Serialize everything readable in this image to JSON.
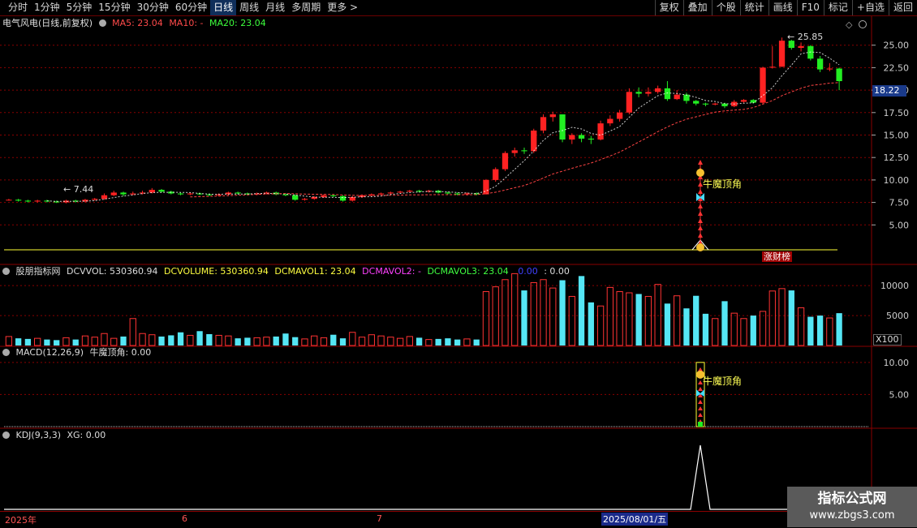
{
  "toolbar": {
    "periods": [
      "分时",
      "1分钟",
      "5分钟",
      "15分钟",
      "30分钟",
      "60分钟",
      "日线",
      "周线",
      "月线",
      "多周期",
      "更多 >"
    ],
    "active_period": "日线",
    "buttons": [
      "复权",
      "叠加",
      "个股",
      "统计",
      "画线",
      "F10",
      "标记",
      "+自选",
      "返回"
    ]
  },
  "main_panel": {
    "title": "电气风电(日线,前复权)",
    "ma5": "MA5: 23.04",
    "ma10": "MA10: -",
    "ma20": "MA20: 23.04",
    "y_ticks": [
      "25.00",
      "22.50",
      "20.00",
      "17.50",
      "15.00",
      "12.50",
      "10.00",
      "7.50",
      "5.00"
    ],
    "price_tag": "18.22",
    "high_label": "25.85",
    "low_label": "7.44",
    "signal_label": "牛魔顶角",
    "badge_label": "涨财榜"
  },
  "volume_panel": {
    "title": "股朋指标网",
    "dcvvol": "DCVVOL: 530360.94",
    "dcvolume": "DCVOLUME: 530360.94",
    "dcmavol1": "DCMAVOL1: 23.04",
    "dcmavol2": "DCMAVOL2: -",
    "dcmavol3": "DCMAVOL3: 23.04",
    "extra1": "0.00",
    "extra2": ": 0.00",
    "y_ticks": [
      "10000",
      "5000"
    ],
    "unit": "X100"
  },
  "macd_panel": {
    "title": "MACD(12,26,9)",
    "value": "牛魔顶角: 0.00",
    "y_ticks": [
      "10.00",
      "5.00"
    ],
    "signal_label": "牛魔顶角"
  },
  "kdj_panel": {
    "title": "KDJ(9,3,3)",
    "value": "XG: 0.00"
  },
  "date_axis": {
    "labels": [
      "2025年",
      "6",
      "7"
    ],
    "cursor_date": "2025/08/01/五"
  },
  "watermark": {
    "title": "指标公式网",
    "url": "www.zbgs3.com"
  },
  "colors": {
    "up": "#ff2222",
    "down": "#22ee22",
    "vol_up": "#ff3333",
    "vol_down": "#55e6f5",
    "grid": "#8a0000",
    "ma5": "#ffffff",
    "ma20": "#ff4444"
  },
  "chart_data": {
    "type": "candlestick",
    "price_range": [
      2.5,
      27.5
    ],
    "candles": [
      [
        7.8,
        7.8,
        7.9,
        7.7
      ],
      [
        7.8,
        7.7,
        7.9,
        7.6
      ],
      [
        7.7,
        7.6,
        7.8,
        7.5
      ],
      [
        7.6,
        7.7,
        7.8,
        7.5
      ],
      [
        7.7,
        7.6,
        7.8,
        7.5
      ],
      [
        7.6,
        7.5,
        7.7,
        7.44
      ],
      [
        7.5,
        7.7,
        7.8,
        7.4
      ],
      [
        7.7,
        7.6,
        7.8,
        7.5
      ],
      [
        7.6,
        7.8,
        7.9,
        7.5
      ],
      [
        7.8,
        7.9,
        8.0,
        7.7
      ],
      [
        7.9,
        8.3,
        8.5,
        7.8
      ],
      [
        8.3,
        8.6,
        8.8,
        8.2
      ],
      [
        8.6,
        8.4,
        8.7,
        8.2
      ],
      [
        8.4,
        8.5,
        8.7,
        8.3
      ],
      [
        8.5,
        8.6,
        8.8,
        8.4
      ],
      [
        8.6,
        8.9,
        9.1,
        8.5
      ],
      [
        8.9,
        8.7,
        9.0,
        8.6
      ],
      [
        8.7,
        8.5,
        8.8,
        8.4
      ],
      [
        8.5,
        8.4,
        8.6,
        8.3
      ],
      [
        8.4,
        8.5,
        8.6,
        8.3
      ],
      [
        8.5,
        8.4,
        8.6,
        8.3
      ],
      [
        8.4,
        8.3,
        8.5,
        8.2
      ],
      [
        8.3,
        8.4,
        8.5,
        8.2
      ],
      [
        8.4,
        8.6,
        8.7,
        8.3
      ],
      [
        8.6,
        8.5,
        8.7,
        8.4
      ],
      [
        8.5,
        8.4,
        8.6,
        8.3
      ],
      [
        8.4,
        8.5,
        8.6,
        8.3
      ],
      [
        8.5,
        8.6,
        8.7,
        8.4
      ],
      [
        8.6,
        8.4,
        8.7,
        8.3
      ],
      [
        8.4,
        8.3,
        8.5,
        8.2
      ],
      [
        8.3,
        7.8,
        8.4,
        7.7
      ],
      [
        7.8,
        7.9,
        8.0,
        7.7
      ],
      [
        7.9,
        8.1,
        8.2,
        7.8
      ],
      [
        8.1,
        8.3,
        8.4,
        8.0
      ],
      [
        8.3,
        8.2,
        8.4,
        8.1
      ],
      [
        8.2,
        7.7,
        8.3,
        7.6
      ],
      [
        7.7,
        8.1,
        8.2,
        7.6
      ],
      [
        8.1,
        8.3,
        8.4,
        8.0
      ],
      [
        8.3,
        8.4,
        8.5,
        8.2
      ],
      [
        8.4,
        8.5,
        8.6,
        8.3
      ],
      [
        8.5,
        8.6,
        8.7,
        8.4
      ],
      [
        8.6,
        8.7,
        8.8,
        8.5
      ],
      [
        8.7,
        8.8,
        8.9,
        8.6
      ],
      [
        8.8,
        8.7,
        8.9,
        8.6
      ],
      [
        8.7,
        8.8,
        8.9,
        8.6
      ],
      [
        8.8,
        8.6,
        8.9,
        8.5
      ],
      [
        8.6,
        8.5,
        8.7,
        8.4
      ],
      [
        8.5,
        8.4,
        8.6,
        8.3
      ],
      [
        8.4,
        8.5,
        8.6,
        8.3
      ],
      [
        8.5,
        8.4,
        8.6,
        8.3
      ],
      [
        8.4,
        10.0,
        10.1,
        8.4
      ],
      [
        10.0,
        11.2,
        11.4,
        9.8
      ],
      [
        11.2,
        13.0,
        13.2,
        11.0
      ],
      [
        13.0,
        13.3,
        13.6,
        12.6
      ],
      [
        13.3,
        13.2,
        13.6,
        12.9
      ],
      [
        13.2,
        15.5,
        15.7,
        13.0
      ],
      [
        15.5,
        17.0,
        17.3,
        15.2
      ],
      [
        17.0,
        17.3,
        17.6,
        16.5
      ],
      [
        17.3,
        14.5,
        17.3,
        14.2
      ],
      [
        14.5,
        15.0,
        15.2,
        14.0
      ],
      [
        15.0,
        14.6,
        15.2,
        14.2
      ],
      [
        14.6,
        14.5,
        14.9,
        14.0
      ],
      [
        14.5,
        16.3,
        16.6,
        14.4
      ],
      [
        16.3,
        16.8,
        17.2,
        16.0
      ],
      [
        16.8,
        17.5,
        17.8,
        16.5
      ],
      [
        17.5,
        19.8,
        20.2,
        17.3
      ],
      [
        19.8,
        19.6,
        20.3,
        19.2
      ],
      [
        19.6,
        19.8,
        20.3,
        19.3
      ],
      [
        19.8,
        20.2,
        20.5,
        19.6
      ],
      [
        20.2,
        19.0,
        21.0,
        18.8
      ],
      [
        19.0,
        19.5,
        20.0,
        18.9
      ],
      [
        19.5,
        18.8,
        19.7,
        18.5
      ],
      [
        18.8,
        18.5,
        18.9,
        18.3
      ],
      [
        18.5,
        18.4,
        18.6,
        18.2
      ],
      [
        18.4,
        18.5,
        18.6,
        18.3
      ],
      [
        18.5,
        18.2,
        18.6,
        18.0
      ],
      [
        18.2,
        18.7,
        18.9,
        18.1
      ],
      [
        18.7,
        18.9,
        19.0,
        18.6
      ],
      [
        18.9,
        18.6,
        19.0,
        18.5
      ],
      [
        18.6,
        22.5,
        22.6,
        18.5
      ],
      [
        22.5,
        22.6,
        24.9,
        22.4
      ],
      [
        22.6,
        25.5,
        25.85,
        22.6
      ],
      [
        25.5,
        24.7,
        25.6,
        24.5
      ],
      [
        24.7,
        24.9,
        25.3,
        24.3
      ],
      [
        24.9,
        23.5,
        25.0,
        23.3
      ],
      [
        23.5,
        22.3,
        23.8,
        22.0
      ],
      [
        22.3,
        22.4,
        23.0,
        22.1
      ],
      [
        22.4,
        21.0,
        22.5,
        20.0
      ]
    ],
    "volume": [
      1500,
      1200,
      1100,
      1200,
      1000,
      900,
      1300,
      1000,
      1600,
      1400,
      2000,
      1200,
      1500,
      4500,
      2000,
      1800,
      1500,
      1700,
      2200,
      1700,
      2400,
      1900,
      1700,
      1600,
      1200,
      1300,
      1300,
      1400,
      1500,
      2000,
      1400,
      1100,
      1600,
      1300,
      1800,
      1200,
      2200,
      1400,
      1800,
      1600,
      1400,
      1200,
      1500,
      1300,
      1000,
      1100,
      1200,
      1000,
      1100,
      1000,
      9000,
      9800,
      11000,
      12000,
      9200,
      10500,
      11000,
      9600,
      10900,
      8200,
      11600,
      7200,
      6600,
      9700,
      9000,
      8800,
      8600,
      8200,
      10200,
      7000,
      8300,
      6200,
      8300,
      5300,
      4500,
      7400,
      5400,
      4500,
      5000,
      5700,
      9100,
      9500,
      9200,
      6300,
      4800,
      5000,
      4600,
      5400
    ],
    "volume_max": 13000,
    "macd_signal": 10.0,
    "kdj_xg_peak": 1.0
  }
}
